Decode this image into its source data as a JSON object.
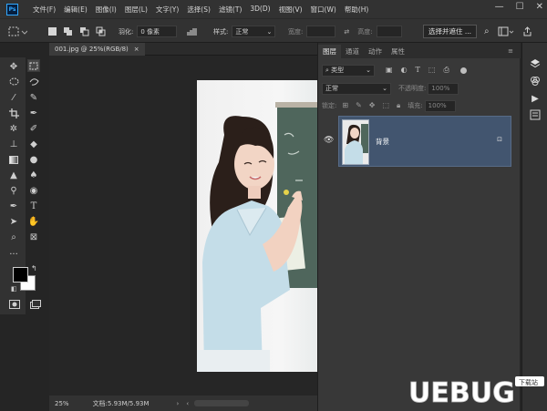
{
  "app": {
    "logo_text": "Ps"
  },
  "menu": [
    "文件(F)",
    "编辑(E)",
    "图像(I)",
    "图层(L)",
    "文字(Y)",
    "选择(S)",
    "滤镜(T)",
    "3D(D)",
    "视图(V)",
    "窗口(W)",
    "帮助(H)"
  ],
  "window_controls": {
    "minimize": "—",
    "maximize": "☐",
    "close": "✕"
  },
  "options": {
    "feather_label": "羽化:",
    "feather_value": "0 像素",
    "antialias_label": "消除锯齿",
    "style_label": "样式:",
    "style_value": "正常",
    "width_label": "宽度:",
    "height_label": "高度:",
    "select_mask_button": "选择并遮住 ..."
  },
  "document": {
    "tab_title": "001.jpg @ 25%(RGB/8)",
    "close": "×"
  },
  "status": {
    "zoom": "25%",
    "doc_info": "文档:5.93M/5.93M"
  },
  "panel": {
    "tabs": [
      "图层",
      "通道",
      "动作",
      "属性"
    ],
    "filter_kind": "类型",
    "blend_mode": "正常",
    "opacity_label": "不透明度:",
    "opacity_value": "100%",
    "lock_label": "锁定:",
    "fill_label": "填充:",
    "fill_value": "100%",
    "layers": [
      {
        "name": "背景",
        "visible": true,
        "locked": true
      }
    ]
  },
  "watermark": {
    "text": "UEBUG",
    "tag": "下载站"
  },
  "colors": {
    "accent": "#31a8ff",
    "layer_selected": "#42556f",
    "canvas": "#262626"
  }
}
